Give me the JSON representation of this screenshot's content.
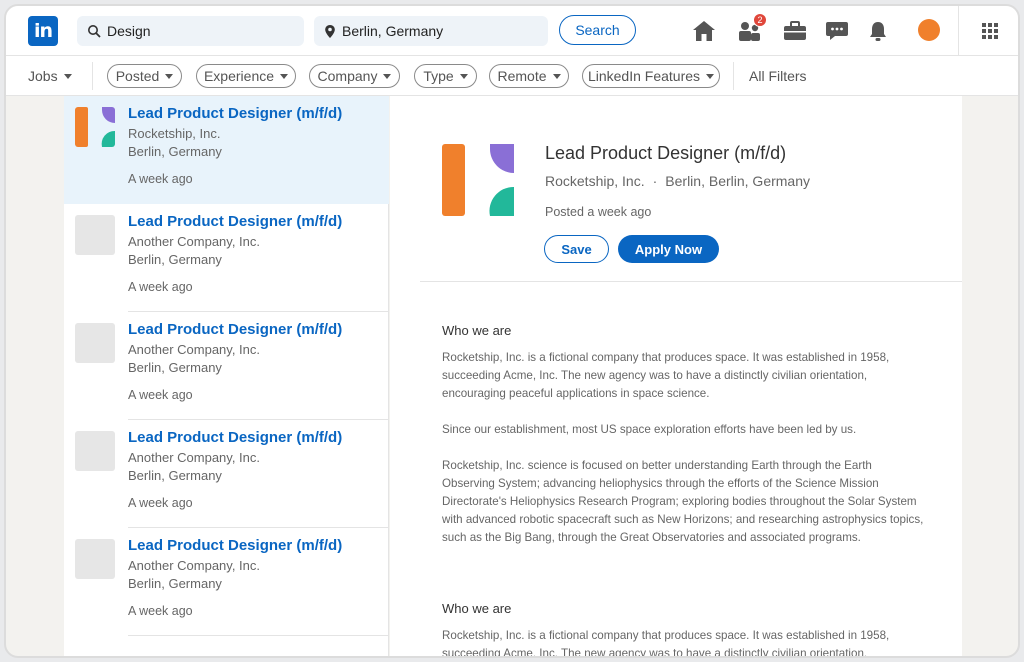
{
  "nav": {
    "logo_text": "in",
    "search_keyword": "Design",
    "search_location": "Berlin, Germany",
    "search_button": "Search",
    "notification_count": "2"
  },
  "filters": {
    "jobs_label": "Jobs",
    "pills": [
      "Posted",
      "Experience",
      "Company",
      "Type",
      "Remote",
      "LinkedIn Features"
    ],
    "all_filters": "All Filters"
  },
  "jobs": [
    {
      "title": "Lead Product Designer (m/f/d)",
      "company": "Rocketship, Inc.",
      "location": "Berlin, Germany",
      "posted": "A week ago"
    },
    {
      "title": "Lead Product Designer (m/f/d)",
      "company": "Another Company, Inc.",
      "location": "Berlin, Germany",
      "posted": "A week ago"
    },
    {
      "title": "Lead Product Designer (m/f/d)",
      "company": "Another Company, Inc.",
      "location": "Berlin, Germany",
      "posted": "A week ago"
    },
    {
      "title": "Lead Product Designer (m/f/d)",
      "company": "Another Company, Inc.",
      "location": "Berlin, Germany",
      "posted": "A week ago"
    },
    {
      "title": "Lead Product Designer (m/f/d)",
      "company": "Another Company, Inc.",
      "location": "Berlin, Germany",
      "posted": "A week ago"
    }
  ],
  "detail": {
    "title": "Lead Product Designer (m/f/d)",
    "company": "Rocketship, Inc.",
    "dot": "·",
    "location": "Berlin, Berlin, Germany",
    "posted": "Posted a week ago",
    "save_label": "Save",
    "apply_label": "Apply Now",
    "section1_heading": "Who we are",
    "para1": "Rocketship, Inc. is a fictional company that produces space. It was established in 1958, succeeding Acme, Inc. The new agency was to have a distinctly civilian orientation, encouraging peaceful applications in space science.",
    "para2": "Since our establishment, most US space exploration efforts have been led by us.",
    "para3": "Rocketship, Inc. science is focused on better understanding Earth through the Earth Observing System; advancing heliophysics through the efforts of the Science Mission Directorate's Heliophysics Research Program; exploring bodies throughout the Solar System with advanced robotic spacecraft such as New Horizons; and researching astrophysics topics, such as the Big Bang, through the Great Observatories and associated programs.",
    "section2_heading": "Who we are",
    "para4": "Rocketship, Inc. is a fictional company that produces space. It was established in 1958, succeeding Acme, Inc. The new agency was to have a distinctly civilian orientation,"
  },
  "colors": {
    "brand": "#0a66c2",
    "logo_orange": "#f0802c",
    "logo_purple": "#8a6fd6",
    "logo_teal": "#22b89a"
  }
}
